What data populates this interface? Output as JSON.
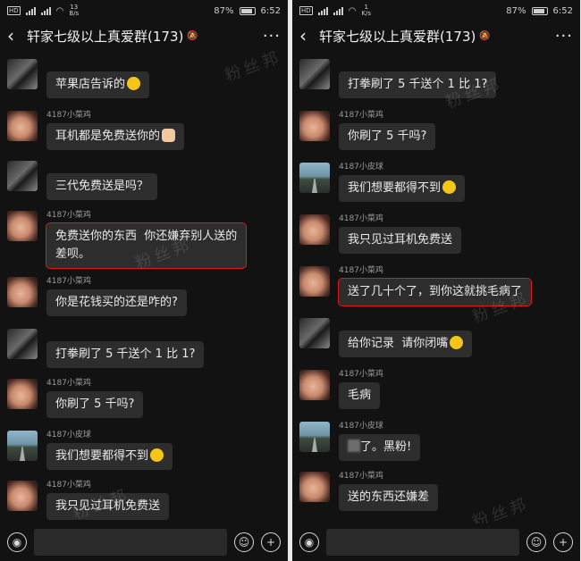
{
  "status": {
    "left": {
      "speed_value": "13",
      "speed_unit": "B/s"
    },
    "right": {
      "speed_value": "1",
      "speed_unit": "K/s"
    },
    "battery": "87%",
    "time": "6:52"
  },
  "header": {
    "title": "轩家七级以上真爱群(173)",
    "more": "···"
  },
  "watermark": "粉丝邦",
  "left_messages": [
    {
      "sender": "",
      "text": "苹果店告诉的",
      "emoji": "smile",
      "avatar": "boy",
      "hl": false
    },
    {
      "sender": "4187小菜鸡",
      "text": "耳机都是免费送你的",
      "emoji": "hand",
      "avatar": "face",
      "hl": false
    },
    {
      "sender": "",
      "text": "三代免费送是吗？",
      "emoji": "",
      "avatar": "boy",
      "hl": false
    },
    {
      "sender": "4187小菜鸡",
      "text": "免费送你的东西  你还嫌弃别人送的\n差呗。",
      "emoji": "",
      "avatar": "face",
      "hl": true
    },
    {
      "sender": "4187小菜鸡",
      "text": "你是花钱买的还是咋的?",
      "emoji": "",
      "avatar": "face",
      "hl": false
    },
    {
      "sender": "",
      "text": "打拳刷了 5 千送个 1 比 1?",
      "emoji": "",
      "avatar": "boy",
      "hl": false
    },
    {
      "sender": "4187小菜鸡",
      "text": "你刷了 5 千吗?",
      "emoji": "",
      "avatar": "face",
      "hl": false
    },
    {
      "sender": "4187小皮球",
      "text": "我们想要都得不到",
      "emoji": "cry",
      "avatar": "road",
      "hl": false
    },
    {
      "sender": "4187小菜鸡",
      "text": "我只见过耳机免费送",
      "emoji": "",
      "avatar": "face",
      "hl": false
    }
  ],
  "right_messages": [
    {
      "sender": "",
      "text": "打拳刷了 5 千送个 1 比 1?",
      "emoji": "",
      "avatar": "boy",
      "hl": false
    },
    {
      "sender": "4187小菜鸡",
      "text": "你刷了 5 千吗?",
      "emoji": "",
      "avatar": "face",
      "hl": false
    },
    {
      "sender": "4187小皮球",
      "text": "我们想要都得不到",
      "emoji": "cry",
      "avatar": "road",
      "hl": false
    },
    {
      "sender": "4187小菜鸡",
      "text": "我只见过耳机免费送",
      "emoji": "",
      "avatar": "face",
      "hl": false
    },
    {
      "sender": "4187小菜鸡",
      "text": "送了几十个了，到你这就挑毛病了",
      "emoji": "",
      "avatar": "face",
      "hl": true
    },
    {
      "sender": "",
      "text": "给你记录  请你闭嘴",
      "emoji": "smile",
      "avatar": "boy",
      "hl": false
    },
    {
      "sender": "4187小菜鸡",
      "text": "毛病",
      "emoji": "",
      "avatar": "face",
      "hl": false
    },
    {
      "sender": "4187小皮球",
      "text": "了。黑粉!",
      "emoji": "",
      "avatar": "road",
      "hl": false,
      "blur_prefix": true
    },
    {
      "sender": "4187小菜鸡",
      "text": "送的东西还嫌差",
      "emoji": "",
      "avatar": "face",
      "hl": false
    }
  ]
}
